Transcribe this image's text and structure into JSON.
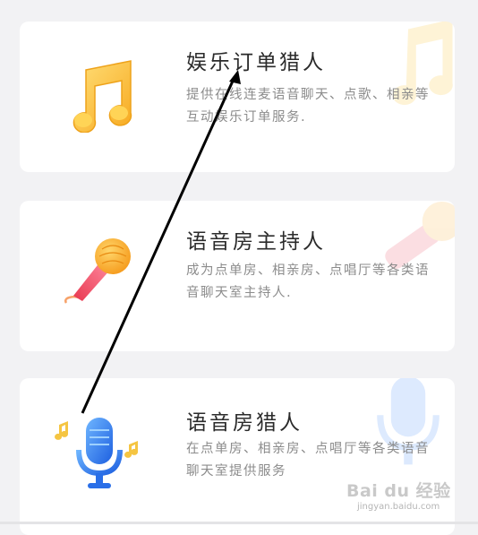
{
  "cards": [
    {
      "title": "娱乐订单猎人",
      "desc": "提供在线连麦语音聊天、点歌、相亲等互动娱乐订单服务.",
      "icon": "music-note-icon"
    },
    {
      "title": "语音房主持人",
      "desc": "成为点单房、相亲房、点唱厅等各类语音聊天室主持人.",
      "icon": "karaoke-microphone-icon"
    },
    {
      "title": "语音房猎人",
      "desc": "在点单房、相亲房、点唱厅等各类语音聊天室提供服务",
      "icon": "studio-microphone-icon"
    }
  ],
  "watermark": {
    "logo": "Bai du 经验",
    "sub": "jingyan.baidu.com"
  },
  "colors": {
    "background": "#f2f2f4",
    "card": "#ffffff",
    "title": "#2b2b2b",
    "desc": "#8c8c8c",
    "annotation_arrow": "#000000"
  }
}
